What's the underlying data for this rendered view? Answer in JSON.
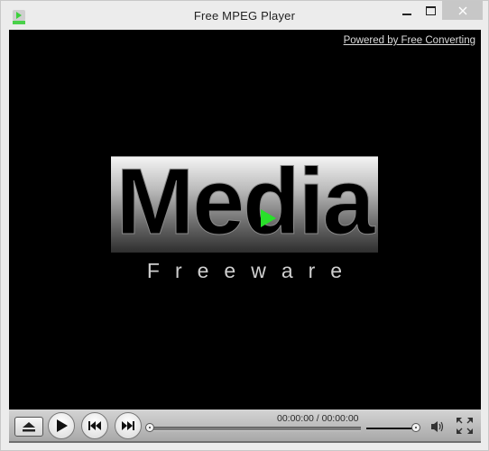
{
  "window": {
    "title": "Free MPEG Player",
    "icon": "mpeg-player-app-icon",
    "buttons": {
      "minimize": "minimize-icon",
      "maximize": "maximize-icon",
      "close": "close-icon"
    }
  },
  "video": {
    "powered_by_link": "Powered by Free Converting",
    "logo": {
      "title": "Media",
      "subtitle": "Freeware",
      "accent_color": "#29e02a"
    }
  },
  "controls": {
    "eject": "eject-icon",
    "play": "play-icon",
    "previous": "previous-track-icon",
    "next": "next-track-icon",
    "time_display": "00:00:00 / 00:00:00",
    "seek_progress": 0,
    "volume_level": 1.0,
    "volume": "speaker-icon",
    "fullscreen": "fullscreen-icon"
  }
}
